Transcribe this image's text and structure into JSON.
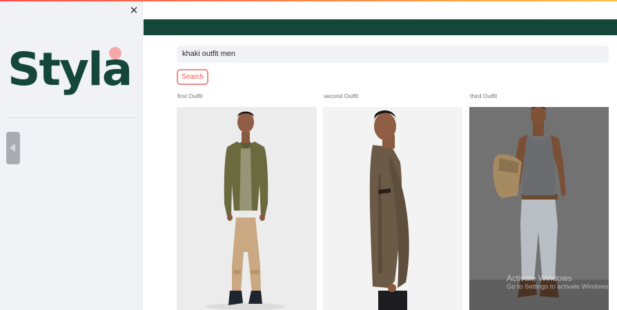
{
  "sidebar": {
    "close_icon": "close-icon",
    "logo_text": "Styla",
    "logo_dot_color": "#f7a8a8",
    "logo_color": "#14473a",
    "collapse_icon": "triangle-left-icon"
  },
  "header": {
    "bar_color": "#14473a"
  },
  "search": {
    "value": "khaki outfit men",
    "button_label": "Search"
  },
  "outfits": [
    {
      "label": "first Outfit",
      "image": "man-olive-shirt-khaki-cargo"
    },
    {
      "label": "second Outfit",
      "image": "man-brown-shirt-side"
    },
    {
      "label": "third Outfit",
      "image": "man-grey-tank-backpack"
    }
  ],
  "watermark": {
    "line1": "Activate Windows",
    "line2": "Go to Settings to activate Windows."
  }
}
